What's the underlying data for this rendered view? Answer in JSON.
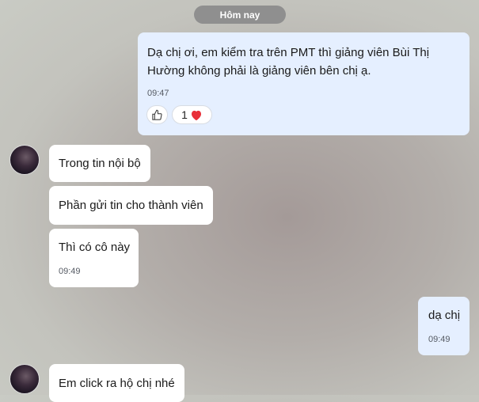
{
  "date_separator": "Hôm nay",
  "messages": [
    {
      "text_line1": "Dạ chị ơi, em kiểm tra trên PMT thì giảng viên Bùi Thị",
      "text_line2": "Hường không phải là giảng viên bên chị ạ.",
      "time": "09:47",
      "reaction_count": "1",
      "reaction_icon": "heart-icon",
      "like_icon": "thumbs-up-icon"
    },
    {
      "text": "Trong tin nội bộ"
    },
    {
      "text": "Phần gửi tin cho thành viên"
    },
    {
      "text": "Thì có cô này",
      "time": "09:49"
    },
    {
      "text": "dạ chị",
      "time": "09:49"
    },
    {
      "text": "Em click ra hộ chị nhé"
    }
  ],
  "colors": {
    "me_bubble": "#e5efff",
    "other_bubble": "#ffffff",
    "date_pill": "#8f8f8f",
    "heart": "#e8303a"
  }
}
